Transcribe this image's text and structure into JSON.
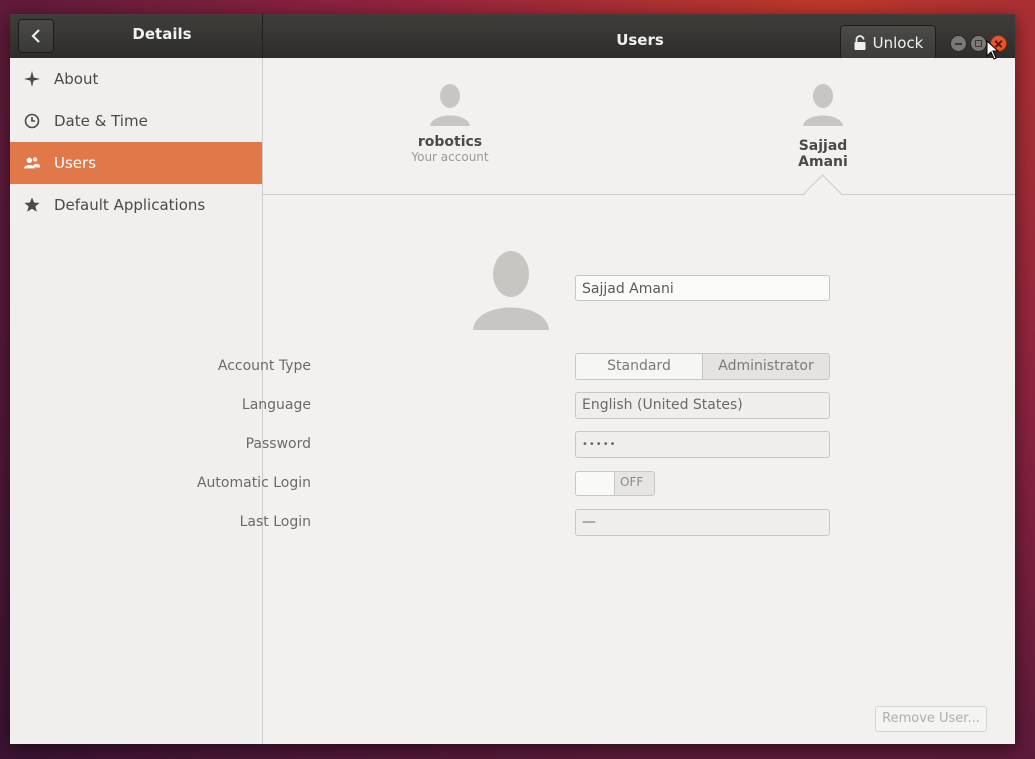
{
  "titlebar": {
    "left_title": "Details",
    "center_title": "Users",
    "unlock_label": "Unlock"
  },
  "sidebar": {
    "items": [
      {
        "label": "About",
        "icon": "sparkle-icon"
      },
      {
        "label": "Date & Time",
        "icon": "clock-icon"
      },
      {
        "label": "Users",
        "icon": "users-icon",
        "active": true
      },
      {
        "label": "Default Applications",
        "icon": "star-icon"
      }
    ]
  },
  "users": [
    {
      "name": "robotics",
      "subtitle": "Your account"
    },
    {
      "name": "Sajjad Amani",
      "subtitle": ""
    }
  ],
  "detail": {
    "full_name": "Sajjad Amani",
    "account_type_label": "Account Type",
    "account_type_options": [
      "Standard",
      "Administrator"
    ],
    "language_label": "Language",
    "language_value": "English (United States)",
    "password_label": "Password",
    "password_value": "•••••",
    "auto_login_label": "Automatic Login",
    "auto_login_state": "OFF",
    "last_login_label": "Last Login",
    "last_login_value": "—",
    "remove_button": "Remove User..."
  },
  "colors": {
    "accent": "#e0784a",
    "close_button": "#e4572e",
    "titlebar": "#353432"
  }
}
